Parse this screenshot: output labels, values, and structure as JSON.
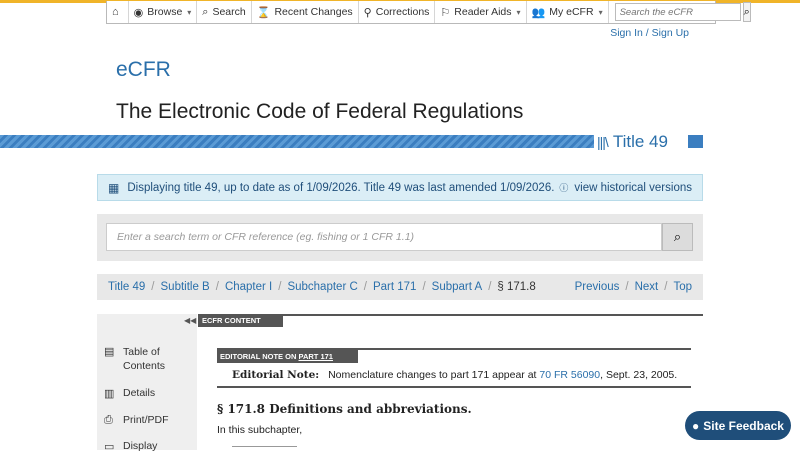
{
  "topnav": {
    "items": [
      {
        "icon": "home-icon",
        "glyph": "⌂",
        "label": ""
      },
      {
        "icon": "eye-icon",
        "glyph": "◉",
        "label": "Browse",
        "caret": "▾"
      },
      {
        "icon": "search-icon",
        "glyph": "⌕",
        "label": "Search"
      },
      {
        "icon": "hourglass-icon",
        "glyph": "⌛",
        "label": "Recent Changes"
      },
      {
        "icon": "person-icon",
        "glyph": "⚲",
        "label": "Corrections"
      },
      {
        "icon": "signpost-icon",
        "glyph": "⚐",
        "label": "Reader Aids",
        "caret": "▾"
      },
      {
        "icon": "users-icon",
        "glyph": "👥",
        "label": "My eCFR",
        "caret": "▾"
      }
    ],
    "search_placeholder": "Search the eCFR",
    "signin": "Sign In / Sign Up"
  },
  "brand": "eCFR",
  "site_title": "The Electronic Code of Federal Regulations",
  "title_badge": "Title 49",
  "notice": {
    "text": "Displaying title 49, up to date as of 1/09/2026. Title 49 was last amended 1/09/2026.",
    "link": "view historical versions"
  },
  "search": {
    "placeholder": "Enter a search term or CFR reference (eg. fishing or 1 CFR 1.1)"
  },
  "breadcrumbs": {
    "items": [
      "Title 49",
      "Subtitle B",
      "Chapter I",
      "Subchapter C",
      "Part 171",
      "Subpart A"
    ],
    "current": "§ 171.8",
    "nav": [
      "Previous",
      "Next",
      "Top"
    ]
  },
  "sidebar": {
    "items": [
      {
        "icon": "book-icon",
        "label": "Table of Contents"
      },
      {
        "icon": "details-icon",
        "label": "Details"
      },
      {
        "icon": "print-icon",
        "label": "Print/PDF"
      },
      {
        "icon": "display-icon",
        "label": "Display"
      }
    ]
  },
  "content": {
    "tab_label": "ECFR CONTENT",
    "editorial": {
      "tab_prefix": "EDITORIAL NOTE ON",
      "tab_link": "PART 171",
      "label": "Editorial Note:",
      "text_before": "Nomenclature changes to part 171 appear at",
      "link": "70 FR 56090",
      "text_after": ", Sept. 23, 2005."
    },
    "section_heading": "§ 171.8 Definitions and abbreviations.",
    "section_body": "In this subchapter,"
  },
  "feedback": "Site Feedback"
}
